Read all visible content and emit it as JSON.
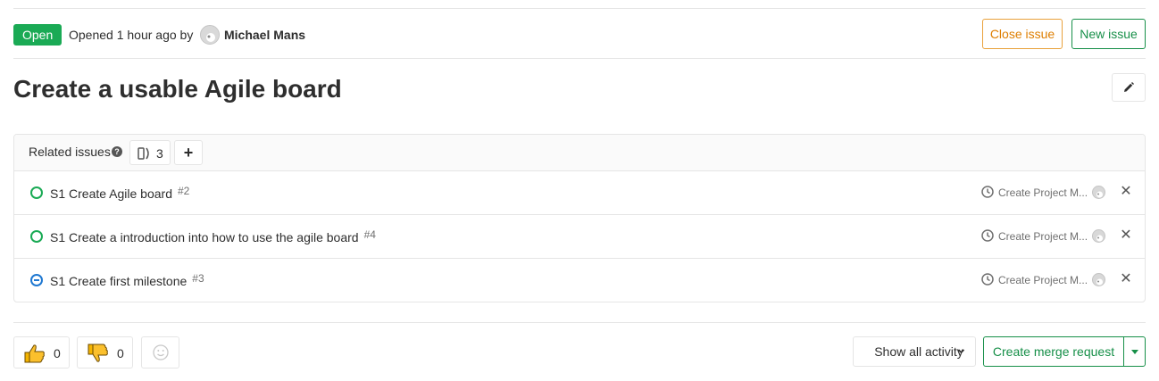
{
  "header": {
    "status": "Open",
    "opened_text": "Opened 1 hour ago by",
    "author": "Michael Mans",
    "close_issue_label": "Close issue",
    "new_issue_label": "New issue"
  },
  "issue": {
    "title": "Create a usable Agile board"
  },
  "related_issues": {
    "label": "Related issues",
    "count": "3",
    "items": [
      {
        "state": "open",
        "title": "S1 Create Agile board",
        "ref": "#2",
        "milestone": "Create Project M..."
      },
      {
        "state": "open",
        "title": "S1 Create a introduction into how to use the agile board",
        "ref": "#4",
        "milestone": "Create Project M..."
      },
      {
        "state": "closed",
        "title": "S1 Create first milestone",
        "ref": "#3",
        "milestone": "Create Project M..."
      }
    ]
  },
  "footer": {
    "thumbs_up_count": "0",
    "thumbs_down_count": "0",
    "activity_filter": "Show all activity",
    "create_mr_label": "Create merge request"
  },
  "colors": {
    "open_green": "#1aaa55",
    "close_orange": "#de7e00",
    "closed_blue": "#1f78d1",
    "mr_green": "#168f48"
  }
}
